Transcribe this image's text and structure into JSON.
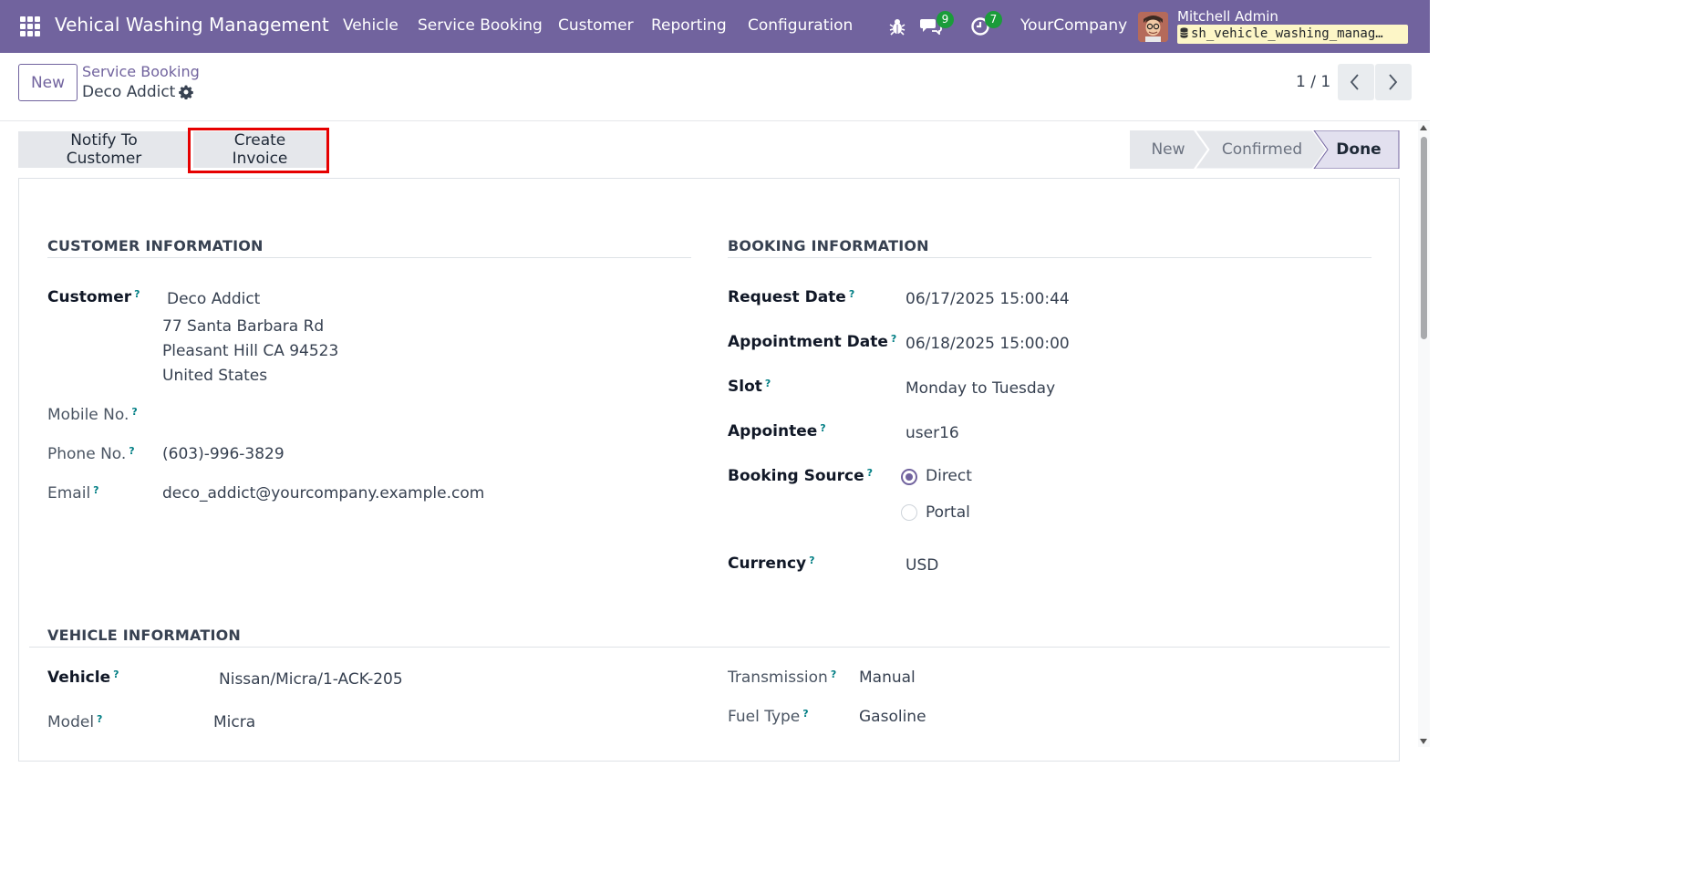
{
  "navbar": {
    "brand": "Vehical Washing Management",
    "menu": [
      "Vehicle",
      "Service Booking",
      "Customer",
      "Reporting",
      "Configuration"
    ],
    "messages_count": "9",
    "activities_count": "7",
    "company": "YourCompany",
    "user_name": "Mitchell Admin",
    "db_name": "sh_vehicle_washing_manag…",
    "accent": "#71639e"
  },
  "control": {
    "new_label": "New",
    "breadcrumb": "Service Booking",
    "record_title": "Deco Addict",
    "pager": "1 / 1"
  },
  "statusbar": {
    "buttons": [
      "Notify To Customer",
      "Create Invoice"
    ],
    "stages": [
      "New",
      "Confirmed",
      "Done"
    ],
    "active_stage": "Done"
  },
  "customer_info": {
    "title": "CUSTOMER INFORMATION",
    "customer_label": "Customer",
    "customer_name": "Deco Addict",
    "address_line1": "77 Santa Barbara Rd",
    "address_line2": "Pleasant Hill CA 94523",
    "address_line3": "United States",
    "mobile_label": "Mobile No.",
    "mobile": "",
    "phone_label": "Phone No.",
    "phone": "(603)-996-3829",
    "email_label": "Email",
    "email": "deco_addict@yourcompany.example.com"
  },
  "booking_info": {
    "title": "BOOKING INFORMATION",
    "request_date_label": "Request Date",
    "request_date": "06/17/2025 15:00:44",
    "appointment_date_label": "Appointment Date",
    "appointment_date": "06/18/2025 15:00:00",
    "slot_label": "Slot",
    "slot": "Monday to Tuesday",
    "appointee_label": "Appointee",
    "appointee": "user16",
    "booking_source_label": "Booking Source",
    "booking_source_options": [
      "Direct",
      "Portal"
    ],
    "booking_source_selected": "Direct",
    "currency_label": "Currency",
    "currency": "USD"
  },
  "vehicle_info": {
    "title": "VEHICLE INFORMATION",
    "vehicle_label": "Vehicle",
    "vehicle": "Nissan/Micra/1-ACK-205",
    "model_label": "Model",
    "model": "Micra",
    "transmission_label": "Transmission",
    "transmission": "Manual",
    "fuel_type_label": "Fuel Type",
    "fuel_type": "Gasoline"
  },
  "help_mark": "?"
}
